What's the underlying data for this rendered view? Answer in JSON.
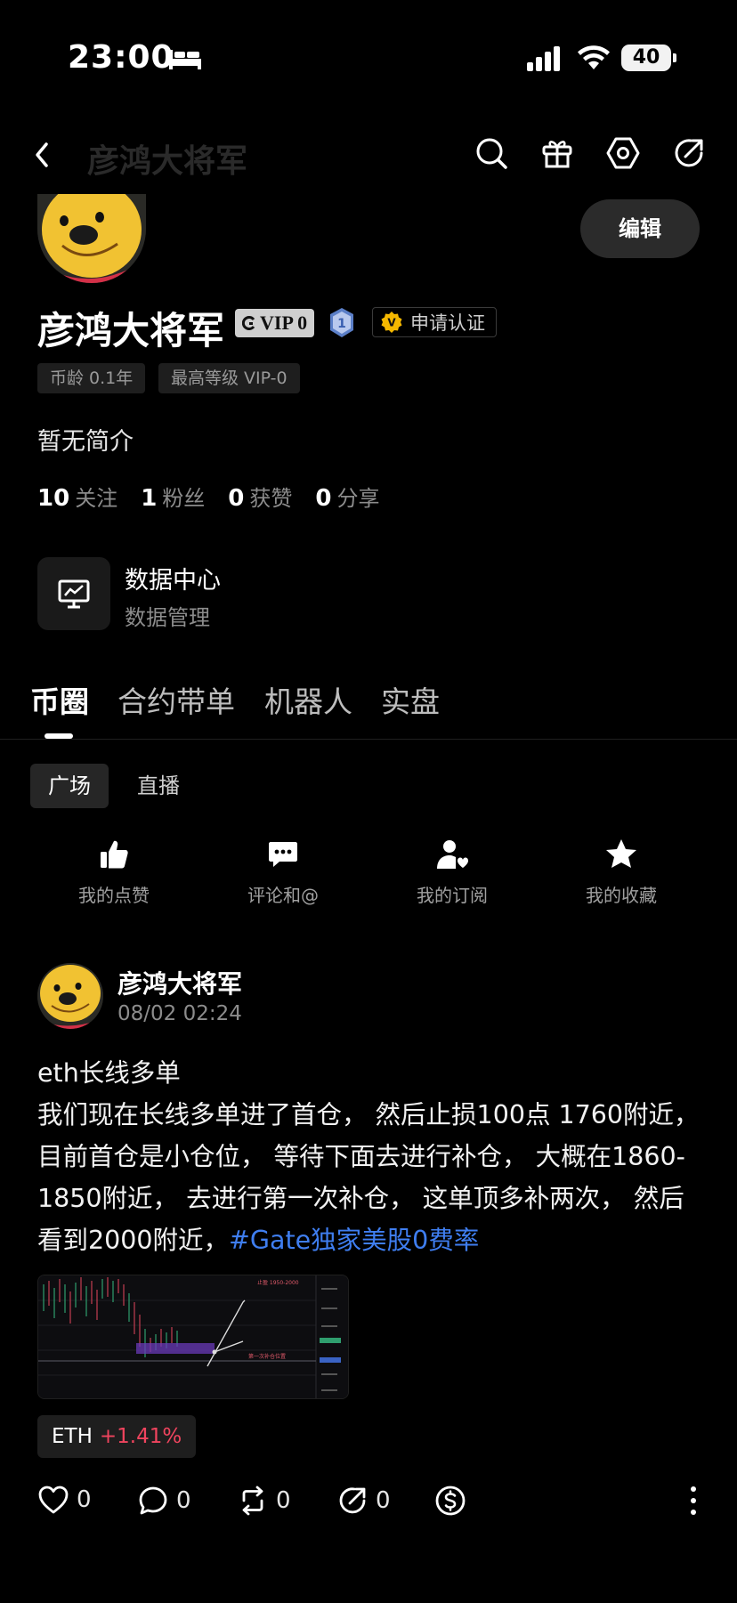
{
  "status_bar": {
    "time": "23:00",
    "battery": "40"
  },
  "nav": {
    "title": "彦鸿大将军"
  },
  "profile": {
    "edit_label": "编辑",
    "name": "彦鸿大将军",
    "vip": "VIP 0",
    "level": "1",
    "verify_label": "申请认证",
    "tags": [
      "币龄 0.1年",
      "最高等级 VIP-0"
    ],
    "bio": "暂无简介",
    "stats": [
      {
        "value": "10",
        "label": "关注"
      },
      {
        "value": "1",
        "label": "粉丝"
      },
      {
        "value": "0",
        "label": "获赞"
      },
      {
        "value": "0",
        "label": "分享"
      }
    ]
  },
  "data_center": {
    "title": "数据中心",
    "subtitle": "数据管理"
  },
  "tabs": [
    {
      "label": "币圈",
      "active": true
    },
    {
      "label": "合约带单",
      "active": false
    },
    {
      "label": "机器人",
      "active": false
    },
    {
      "label": "实盘",
      "active": false
    }
  ],
  "sub_tabs": [
    {
      "label": "广场",
      "active": true
    },
    {
      "label": "直播",
      "active": false
    }
  ],
  "actions": [
    {
      "label": "我的点赞",
      "icon": "thumbs-up-icon"
    },
    {
      "label": "评论和@",
      "icon": "comment-icon"
    },
    {
      "label": "我的订阅",
      "icon": "subscribe-icon"
    },
    {
      "label": "我的收藏",
      "icon": "star-icon"
    }
  ],
  "post": {
    "author": "彦鸿大将军",
    "time": "08/02 02:24",
    "title_line": "eth长线多单",
    "body": "我们现在长线多单进了首仓， 然后止损100点 1760附近， 目前首仓是小仓位， 等待下面去进行补仓， 大概在1860-1850附近， 去进行第一次补仓， 这单顶多补两次， 然后看到2000附近，",
    "hashtag": "#Gate独家美股0费率",
    "image_labels": {
      "target": "止盈 1950-2000",
      "add_position": "第一次补仓位置"
    },
    "coin": {
      "symbol": "ETH",
      "change": "+1.41%"
    },
    "counts": {
      "like": "0",
      "comment": "0",
      "repost": "0",
      "share": "0"
    }
  },
  "colors": {
    "accent_link": "#3f7ef0",
    "price_up": "#f0445e",
    "badge_gold": "#f5b800"
  }
}
